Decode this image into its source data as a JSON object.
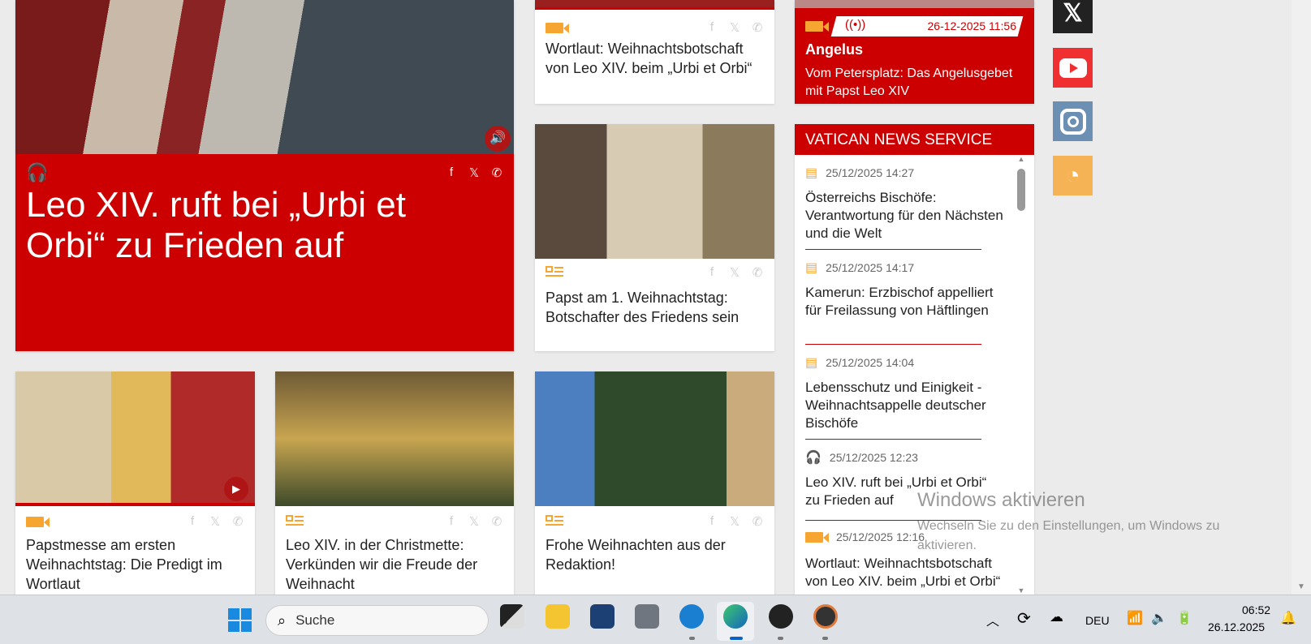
{
  "hero": {
    "title": "Leo XIV. ruft bei „Urbi et Orbi“ zu Frieden auf",
    "media": "headphones-icon"
  },
  "share": {
    "facebook": "f",
    "x": "𝕏",
    "whatsapp": "✆"
  },
  "cards": [
    {
      "title": "Wortlaut: Weihnachtsbotschaft von Leo XIV. beim „Urbi et Orbi“",
      "media": "video"
    },
    {
      "title": "Papst am 1. Weihnachtstag: Botschafter des Friedens sein",
      "media": "text"
    },
    {
      "title": "Papstmesse am ersten Weihnachtstag: Die Predigt im Wortlaut",
      "media": "video"
    },
    {
      "title": "Leo XIV. in der Christmette: Verkünden wir die Freude der Weihnacht",
      "media": "text"
    },
    {
      "title": "Frohe Weihnachten aus der Redaktion!",
      "media": "text"
    }
  ],
  "live": {
    "datetime": "26-12-2025 11:56",
    "title": "Angelus",
    "description": "Vom Petersplatz: Das Angelusgebet mit Papst Leo XIV"
  },
  "vns": {
    "header": "VATICAN NEWS SERVICE",
    "items": [
      {
        "date": "25/12/2025 14:27",
        "title": "Österreichs Bischöfe: Verantwortung für den Nächsten und die Welt"
      },
      {
        "date": "25/12/2025 14:17",
        "title": "Kamerun: Erzbischof appelliert für Freilassung von Häftlingen"
      },
      {
        "date": "25/12/2025 14:04",
        "title": "Lebensschutz und Einigkeit - Weihnachtsappelle deutscher Bischöfe"
      },
      {
        "date": "25/12/2025 12:23",
        "title": "Leo XIV. ruft bei „Urbi et Orbi“ zu Frieden auf"
      },
      {
        "date": "25/12/2025 12:16",
        "title": "Wortlaut: Weihnachtsbotschaft von Leo XIV. beim „Urbi et Orbi“"
      }
    ]
  },
  "watermark": {
    "title": "Windows aktivieren",
    "subtitle": "Wechseln Sie zu den Einstellungen, um Windows zu aktivieren."
  },
  "taskbar": {
    "search_placeholder": "Suche",
    "language": "DEU",
    "time": "06:52",
    "date": "26.12.2025"
  },
  "colors": {
    "brand": "#cc0000",
    "accent": "#f7a531"
  }
}
